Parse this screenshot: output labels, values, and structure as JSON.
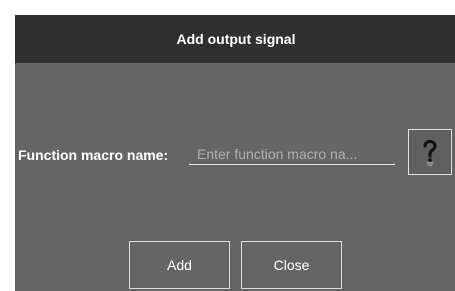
{
  "dialog": {
    "title": "Add output signal",
    "field_label": "Function macro name:",
    "field_value": "",
    "field_placeholder": "Enter function macro na...",
    "help_icon": "question-lightbulb-icon",
    "buttons": {
      "add_label": "Add",
      "close_label": "Close"
    }
  },
  "colors": {
    "titlebar": "#303030",
    "body": "#656565",
    "text": "#ffffff",
    "placeholder": "#b0b0b0",
    "border": "#dcdcdc"
  }
}
